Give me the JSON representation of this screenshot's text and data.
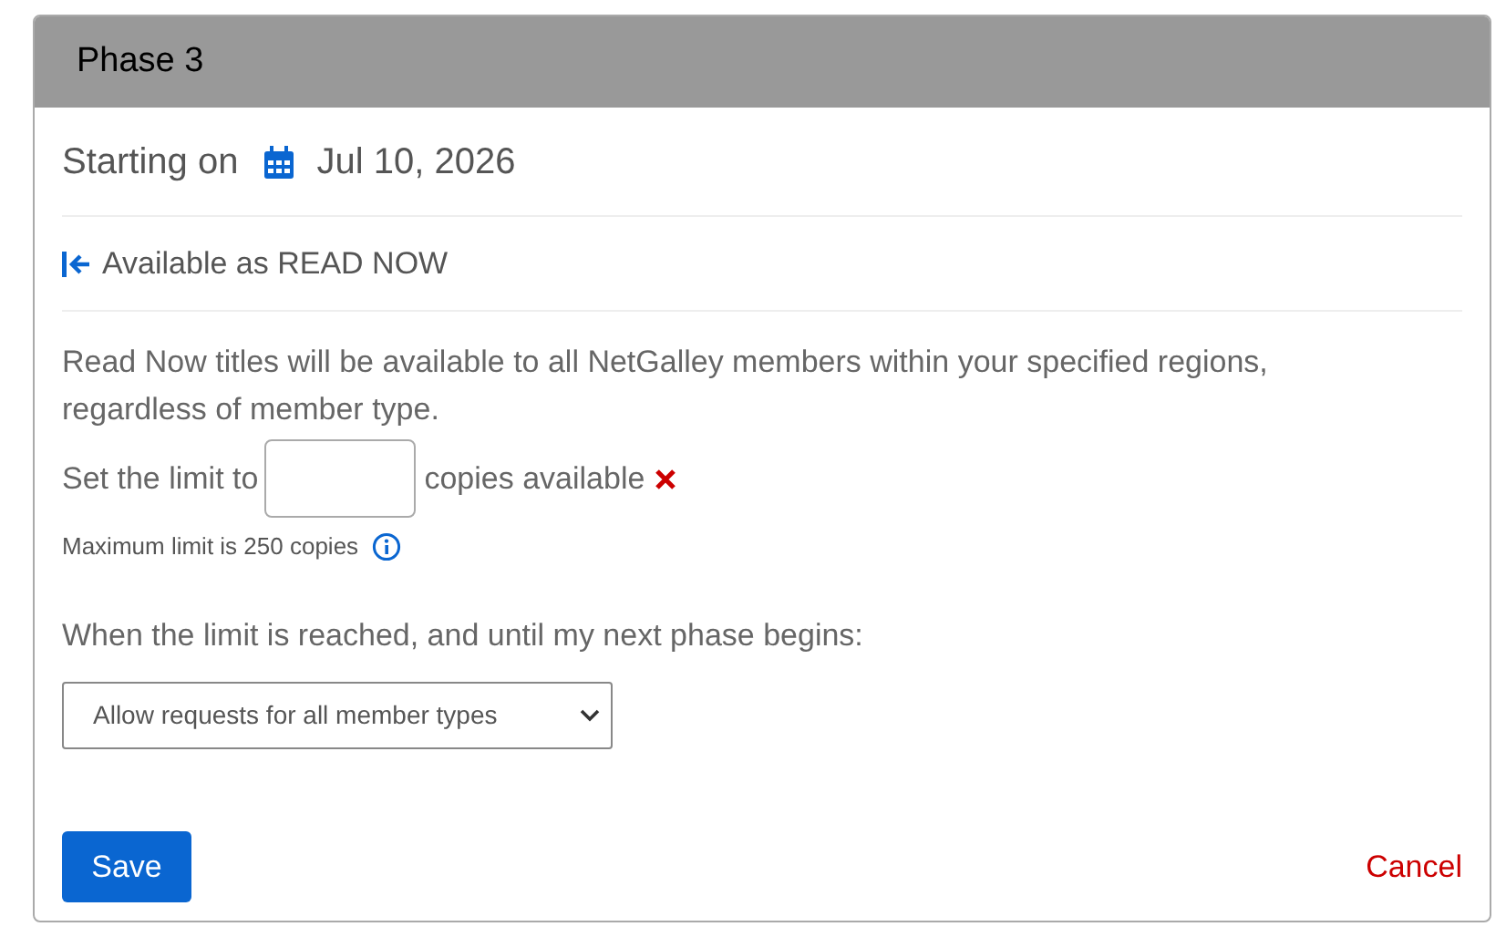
{
  "panel": {
    "title": "Phase 3"
  },
  "start": {
    "label": "Starting on",
    "date": "Jul 10, 2026"
  },
  "availability": {
    "label": "Available as READ NOW"
  },
  "description": "Read Now titles will be available to all NetGalley members within your specified regions, regardless of member type.",
  "limit": {
    "prefix": "Set the limit to",
    "suffix": "copies available",
    "hint": "Maximum limit is 250 copies"
  },
  "limit_reached": {
    "label": "When the limit is reached, and until my next phase begins:",
    "value": "Allow requests for all member types"
  },
  "buttons": {
    "save": "Save",
    "cancel": "Cancel"
  }
}
